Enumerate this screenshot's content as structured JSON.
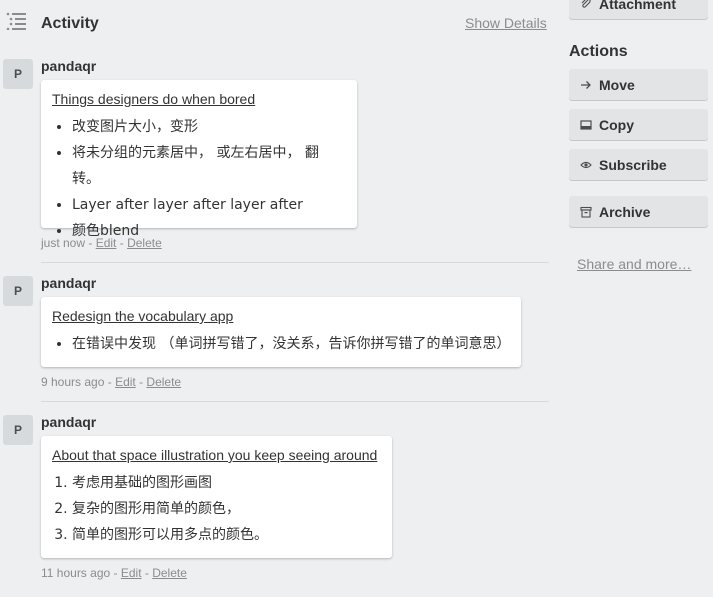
{
  "activity": {
    "title": "Activity",
    "show_details_label": "Show Details"
  },
  "entries": [
    {
      "avatar_initial": "P",
      "username": "pandaqr",
      "card_title": "Things designers do when bored",
      "list_type": "bullet",
      "items": [
        "改变图片大小，变形",
        "将未分组的元素居中， 或左右居中， 翻转。",
        "Layer after layer after layer after",
        "颜色blend"
      ],
      "time": "just now",
      "edit_label": "Edit",
      "delete_label": "Delete"
    },
    {
      "avatar_initial": "P",
      "username": "pandaqr",
      "card_title": "Redesign the vocabulary app",
      "list_type": "bullet",
      "items": [
        "在错误中发现 （单词拼写错了，没关系，告诉你拼写错了的单词意思）"
      ],
      "time": "9 hours ago",
      "edit_label": "Edit",
      "delete_label": "Delete"
    },
    {
      "avatar_initial": "P",
      "username": "pandaqr",
      "card_title": "About that space illustration you keep seeing around",
      "list_type": "numbered",
      "items": [
        "考虑用基础的图形画图",
        "复杂的图形用简单的颜色，",
        "简单的图形可以用多点的颜色。"
      ],
      "time": "11 hours ago",
      "edit_label": "Edit",
      "delete_label": "Delete"
    }
  ],
  "sidebar": {
    "attachment_label": "Attachment",
    "actions_heading": "Actions",
    "move_label": "Move",
    "copy_label": "Copy",
    "subscribe_label": "Subscribe",
    "archive_label": "Archive",
    "share_label": "Share and more…"
  }
}
